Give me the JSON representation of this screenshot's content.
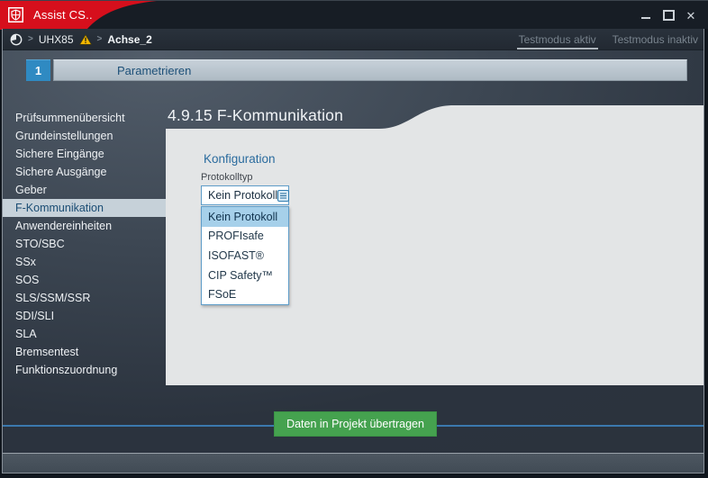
{
  "window": {
    "title": "Assist CS..",
    "controls": {
      "minimize": "minimize",
      "maximize": "maximize",
      "close": "✕"
    }
  },
  "breadcrumb": {
    "separator": ">",
    "device": "UHX85",
    "axis": "Achse_2"
  },
  "testmodus": {
    "active_label": "Testmodus aktiv",
    "inactive_label": "Testmodus inaktiv"
  },
  "step_bar": {
    "number": "1",
    "label": "Parametrieren"
  },
  "sidebar": {
    "items": [
      "Prüfsummenübersicht",
      "Grundeinstellungen",
      "Sichere Eingänge",
      "Sichere Ausgänge",
      "Geber",
      "F-Kommunikation",
      "Anwendereinheiten",
      "STO/SBC",
      "SSx",
      "SOS",
      "SLS/SSM/SSR",
      "SDI/SLI",
      "SLA",
      "Bremsentest",
      "Funktionszuordnung"
    ],
    "selected_item": "F-Kommunikation"
  },
  "main": {
    "heading": "4.9.15 F-Kommunikation",
    "section_title": "Konfiguration",
    "field_label": "Protokolltyp",
    "combobox_value": "Kein Protokoll",
    "options": [
      "Kein Protokoll",
      "PROFIsafe",
      "ISOFAST®",
      "CIP Safety™",
      "FSoE"
    ],
    "selected_option": "Kein Protokoll"
  },
  "footer": {
    "button_label": "Daten in Projekt übertragen"
  },
  "colors": {
    "brand_red": "#d60f1c",
    "accent_blue": "#2f8ac2",
    "selection_blue": "#a6d0ea",
    "button_green": "#45a24f",
    "panel_gray": "#e3e5e6",
    "line_blue": "#3b79ae"
  }
}
